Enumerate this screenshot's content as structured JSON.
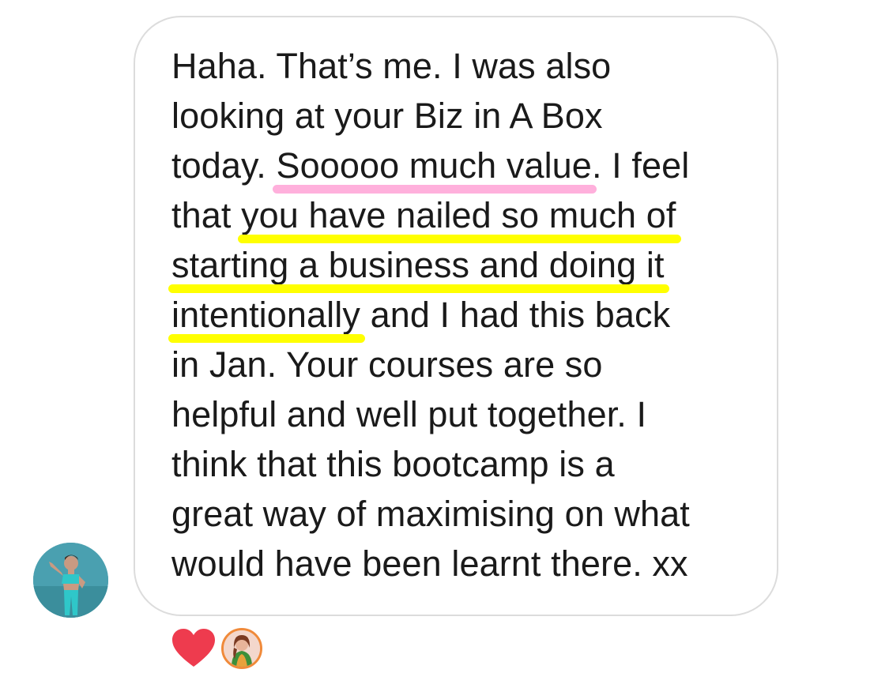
{
  "message": {
    "lines": [
      [
        {
          "text": "Haha. That’s me. I was also"
        }
      ],
      [
        {
          "text": "looking at your Biz in A Box"
        }
      ],
      [
        {
          "text": "today. "
        },
        {
          "text": "Sooooo much value",
          "highlight": "pink"
        },
        {
          "text": ". I feel"
        }
      ],
      [
        {
          "text": "that "
        },
        {
          "text": "you have nailed so much of",
          "highlight": "yellow"
        }
      ],
      [
        {
          "text": "starting a business and doing it",
          "highlight": "yellow"
        }
      ],
      [
        {
          "text": "intentionally",
          "highlight": "yellow"
        },
        {
          "text": " and I had this back"
        }
      ],
      [
        {
          "text": "in Jan. Your courses are so"
        }
      ],
      [
        {
          "text": "helpful and well put together. I"
        }
      ],
      [
        {
          "text": "think that this bootcamp is a"
        }
      ],
      [
        {
          "text": "great way of maximising on what"
        }
      ],
      [
        {
          "text": "would have been learnt there. xx"
        }
      ]
    ]
  },
  "sender": {
    "avatar_icon": "user-avatar-photo",
    "avatar_bg": "#3f96a6"
  },
  "reactions": {
    "emoji_icon": "heart-icon",
    "heart_color": "#ee3b4e",
    "reactor_avatar_icon": "reactor-avatar-photo",
    "highlight_colors": {
      "pink": "#ffb0dc",
      "yellow": "#ffff00"
    }
  }
}
